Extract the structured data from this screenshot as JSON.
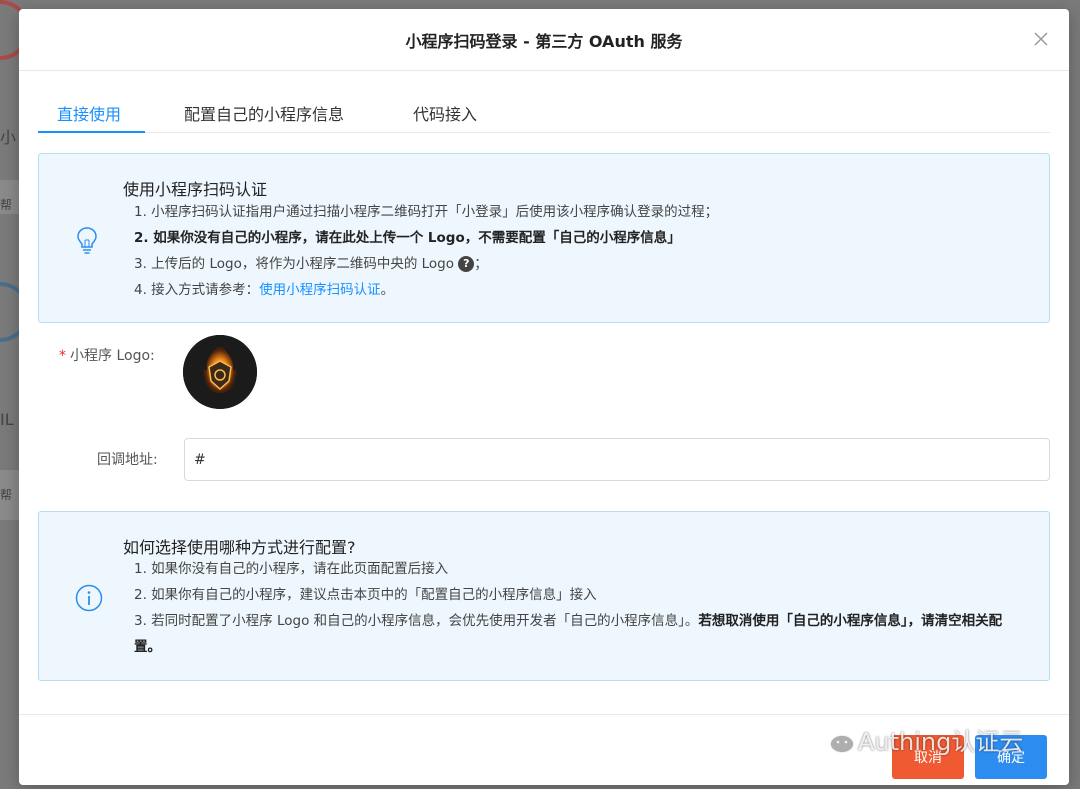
{
  "background": {
    "text_1": "小",
    "text_2": "帮",
    "text_3": "IL",
    "text_4": "帮"
  },
  "modal": {
    "title": "小程序扫码登录 - 第三方 OAuth 服务"
  },
  "tabs": [
    {
      "label": "直接使用",
      "active": true
    },
    {
      "label": "配置自己的小程序信息",
      "active": false
    },
    {
      "label": "代码接入",
      "active": false
    }
  ],
  "intro_box": {
    "icon": "lightbulb-icon",
    "title": "使用小程序扫码认证",
    "item1": "1. 小程序扫码认证指用户通过扫描小程序二维码打开「小登录」后使用该小程序确认登录的过程；",
    "item2": "2. 如果你没有自己的小程序，请在此处上传一个 Logo，不需要配置「自己的小程序信息」",
    "item3": "3. 上传后的 Logo，将作为小程序二维码中央的 Logo",
    "item3_end": "；",
    "item4_prefix": "4. 接入方式请参考：",
    "item4_link": "使用小程序扫码认证",
    "item4_suffix": "。"
  },
  "form": {
    "logo_required_mark": "*",
    "logo_label": "小程序 Logo:",
    "callback_label": "回调地址:",
    "callback_value": "#"
  },
  "config_box": {
    "icon": "info-icon",
    "title": "如何选择使用哪种方式进行配置?",
    "item1": "1. 如果你没有自己的小程序，请在此页面配置后接入",
    "item2": "2. 如果你有自己的小程序，建议点击本页中的「配置自己的小程序信息」接入",
    "item3_normal": "3. 若同时配置了小程序 Logo 和自己的小程序信息，会优先使用开发者「自己的小程序信息」。",
    "item3_bold": "若想取消使用「自己的小程序信息」，请清空相关配置。"
  },
  "footer": {
    "cancel_label": "取消",
    "ok_label": "确定"
  },
  "watermark": {
    "text": "Authing认证云"
  },
  "colors": {
    "accent": "#1890ff",
    "cancel": "#f05a32",
    "ok": "#2d8cf0",
    "info_bg": "#eef7fd",
    "info_border": "#b8def5"
  }
}
